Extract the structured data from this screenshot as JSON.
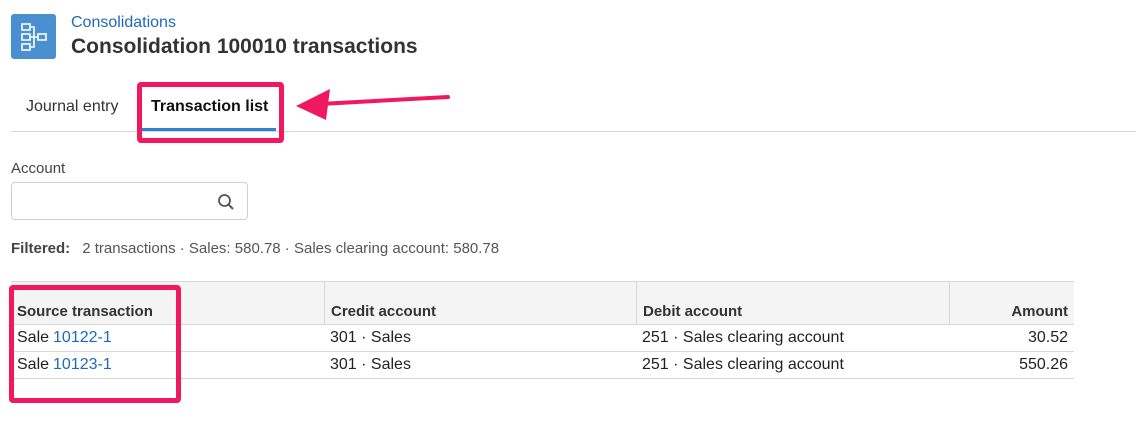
{
  "header": {
    "breadcrumb": "Consolidations",
    "title": "Consolidation 100010 transactions",
    "icon": "consolidation-hierarchy-icon"
  },
  "tabs": [
    {
      "label": "Journal entry",
      "active": false
    },
    {
      "label": "Transaction list",
      "active": true
    }
  ],
  "filter": {
    "account_label": "Account",
    "account_value": "",
    "search_icon": "search-icon"
  },
  "summary": {
    "label": "Filtered:",
    "text": "2 transactions · Sales: 580.78 · Sales clearing account: 580.78"
  },
  "table": {
    "columns": [
      "Source transaction",
      "Credit account",
      "Debit account",
      "Amount"
    ],
    "rows": [
      {
        "source_prefix": "Sale",
        "source_link": "10122-1",
        "credit": "301 · Sales",
        "debit": "251 · Sales clearing account",
        "amount": "30.52"
      },
      {
        "source_prefix": "Sale",
        "source_link": "10123-1",
        "credit": "301 · Sales",
        "debit": "251 · Sales clearing account",
        "amount": "550.26"
      }
    ]
  },
  "colors": {
    "accent": "#2f7fd6",
    "link": "#1e6ab8",
    "annotation": "#f0185f",
    "icon_bg": "#4a8fd0"
  }
}
